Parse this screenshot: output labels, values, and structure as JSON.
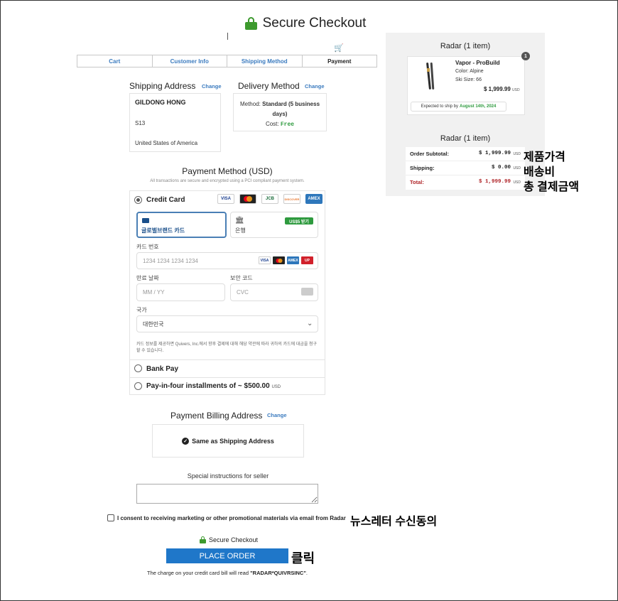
{
  "header": {
    "title": "Secure Checkout"
  },
  "breadcrumbs": [
    "Cart",
    "Customer Info",
    "Shipping Method",
    "Payment"
  ],
  "shipping_address": {
    "title": "Shipping Address",
    "change_label": "Change",
    "name": "GILDONG HONG",
    "line1": "S13",
    "country": "United States of America"
  },
  "delivery": {
    "title": "Delivery Method",
    "change_label": "Change",
    "method_prefix": "Method: ",
    "method_value": "Standard (5 business days)",
    "cost_prefix": "Cost: ",
    "cost_value": "Free"
  },
  "payment": {
    "title": "Payment Method (USD)",
    "subtitle": "All transactions are secure and encrypted using a PCI compliant payment system.",
    "credit_card_label": "Credit Card",
    "card_brands": [
      "VISA",
      "MC",
      "JCB",
      "DISCOVER",
      "AMEX"
    ],
    "tab_card_label": "글로벌브랜드 카드",
    "tab_bank_label": "은행",
    "tab_bank_badge": "US$5 받기",
    "card_number_label": "카드 번호",
    "card_number_placeholder": "1234 1234 1234 1234",
    "mini_brands": [
      "VISA",
      "MC",
      "AMEX",
      "UP"
    ],
    "expiry_label": "만료 날짜",
    "expiry_placeholder": "MM / YY",
    "cvc_label": "보안 코드",
    "cvc_placeholder": "CVC",
    "country_label": "국가",
    "country_value": "대한민국",
    "disclaimer": "카드 정보를 제공하면 Quivers, Inc.에서 향후 결제에 대해 해당 약관에 따라 귀하의 카드에 대금을 청구할 수 있습니다.",
    "bank_pay_label": "Bank Pay",
    "pay_in_four_label": "Pay-in-four installments of ~ $500.00",
    "pay_in_four_usd": "USD"
  },
  "billing": {
    "title": "Payment Billing Address",
    "change_label": "Change",
    "same_label": "Same as Shipping Address"
  },
  "instructions": {
    "label": "Special instructions for seller"
  },
  "consent": {
    "label": "I consent to receiving marketing or other promotional materials via email from Radar"
  },
  "footer": {
    "secure_label": "Secure Checkout",
    "place_order_label": "PLACE ORDER",
    "charge_prefix": "The charge on your credit card bill will read ",
    "charge_value": "\"RADAR*QUIVRSINC\"",
    "charge_suffix": "."
  },
  "summary": {
    "title": "Radar (1 item)",
    "qty": "1",
    "item_name": "Vapor - ProBuild",
    "item_color": "Color: Alpine",
    "item_size": "Ski Size: 66",
    "item_price": "$ 1,999.99",
    "item_price_usd": "USD",
    "ship_prefix": "Expected to ship by",
    "ship_date": "August 14th, 2024"
  },
  "totals": {
    "title": "Radar (1 item)",
    "rows": [
      {
        "label": "Order Subtotal:",
        "value": "$ 1,999.99",
        "usd": "USD"
      },
      {
        "label": "Shipping:",
        "value": "$ 0.00",
        "usd": "USD"
      },
      {
        "label": "Total:",
        "value": "$ 1,999.99",
        "usd": "USD"
      }
    ]
  },
  "annotations": {
    "product_price": "제품가격",
    "shipping_fee": "배송비",
    "total_amount": "총 결제금액",
    "newsletter": "뉴스레터 수신동의",
    "click": "클릭"
  },
  "colors": {
    "accent_green": "#3d9a2e",
    "link_blue": "#3b7bbf",
    "button_blue": "#1f77c9",
    "total_red": "#b0262a"
  }
}
